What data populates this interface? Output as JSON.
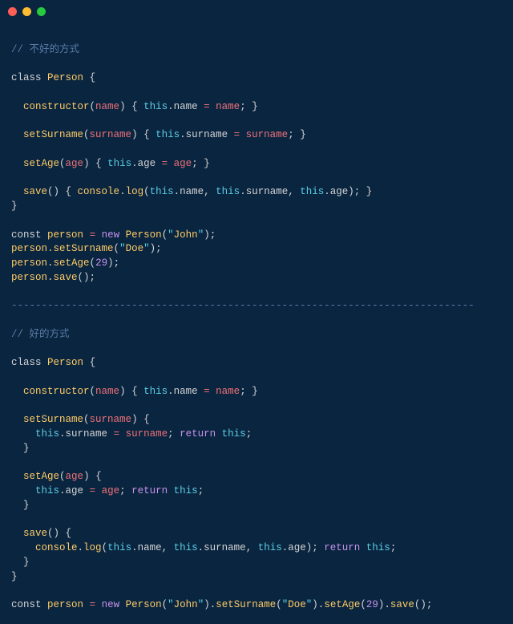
{
  "titlebar": {
    "buttons": [
      "close",
      "minimize",
      "maximize"
    ]
  },
  "code": {
    "comment_bad": "不好的方式",
    "comment_good": "好的方式",
    "separator": "-----------------------------------------------------------------------------",
    "tokens": {
      "class": "class",
      "person": "Person",
      "constructor": "constructor",
      "name_param": "name",
      "this": "this",
      "name_prop": "name",
      "setSurname": "setSurname",
      "surname_param": "surname",
      "surname_prop": "surname",
      "setAge": "setAge",
      "age_param": "age",
      "age_prop": "age",
      "save": "save",
      "console": "console",
      "log": "log",
      "const": "const",
      "person_var": "person",
      "new": "new",
      "john": "John",
      "doe": "Doe",
      "age_29": "29",
      "return": "return"
    }
  }
}
